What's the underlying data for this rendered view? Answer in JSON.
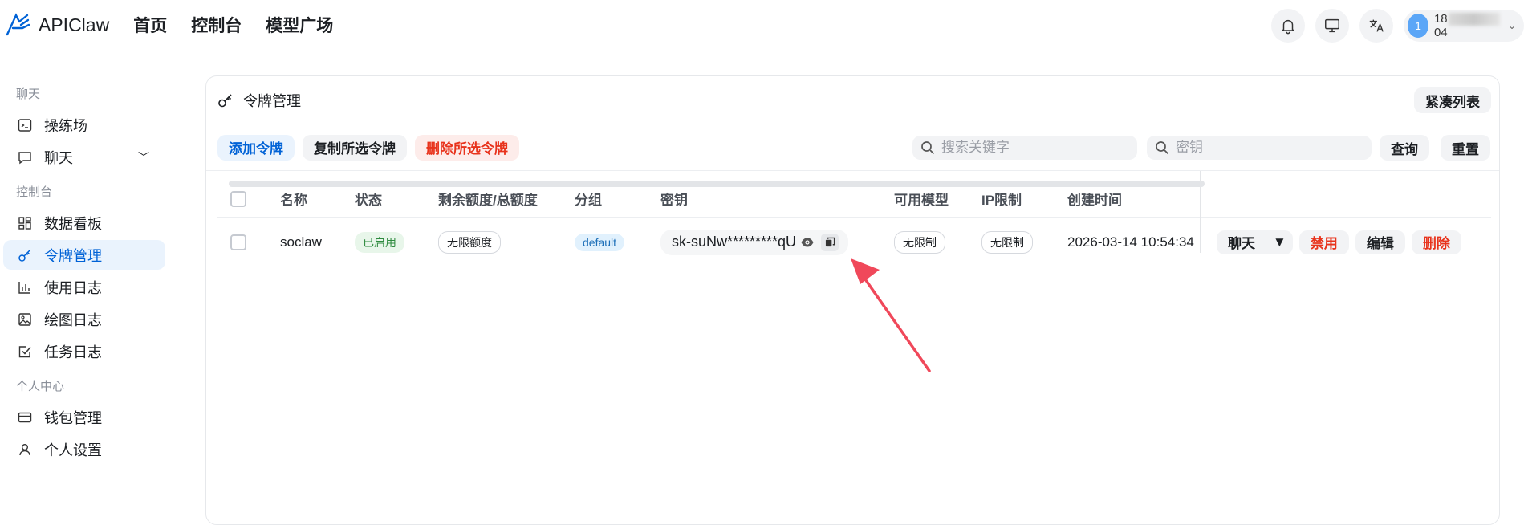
{
  "brand": {
    "name": "APIClaw"
  },
  "topnav": [
    "首页",
    "控制台",
    "模型广场"
  ],
  "topbar": {
    "user_avatar": "1",
    "user_prefix": "18",
    "user_suffix": "04"
  },
  "sidebar": {
    "groups": [
      {
        "title": "聊天",
        "items": [
          {
            "label": "操练场",
            "icon": "terminal-icon"
          },
          {
            "label": "聊天",
            "icon": "chat-icon",
            "expandable": true
          }
        ]
      },
      {
        "title": "控制台",
        "items": [
          {
            "label": "数据看板",
            "icon": "dashboard-icon"
          },
          {
            "label": "令牌管理",
            "icon": "key-icon",
            "active": true
          },
          {
            "label": "使用日志",
            "icon": "bar-chart-icon"
          },
          {
            "label": "绘图日志",
            "icon": "image-icon"
          },
          {
            "label": "任务日志",
            "icon": "checkbox-icon"
          }
        ]
      },
      {
        "title": "个人中心",
        "items": [
          {
            "label": "钱包管理",
            "icon": "wallet-icon"
          },
          {
            "label": "个人设置",
            "icon": "user-icon"
          }
        ]
      }
    ]
  },
  "card": {
    "title": "令牌管理",
    "compact_label": "紧凑列表",
    "toolbar": {
      "add": "添加令牌",
      "copy": "复制所选令牌",
      "delete": "删除所选令牌",
      "search_placeholder": "搜索关键字",
      "key_placeholder": "密钥",
      "query": "查询",
      "reset": "重置"
    },
    "columns": [
      "名称",
      "状态",
      "剩余额度/总额度",
      "分组",
      "密钥",
      "可用模型",
      "IP限制",
      "创建时间"
    ],
    "rows": [
      {
        "name": "soclaw",
        "status": "已启用",
        "quota": "无限额度",
        "group": "default",
        "key": "sk-suNw*********qU",
        "models": "无限制",
        "ip": "无限制",
        "created": "2026-03-14 10:54:34",
        "actions": {
          "chat": "聊天",
          "disable": "禁用",
          "edit": "编辑",
          "delete": "删除"
        }
      }
    ]
  },
  "colors": {
    "accent": "#0062d6",
    "danger": "#e8331c",
    "annotation_arrow": "#f0485a"
  }
}
